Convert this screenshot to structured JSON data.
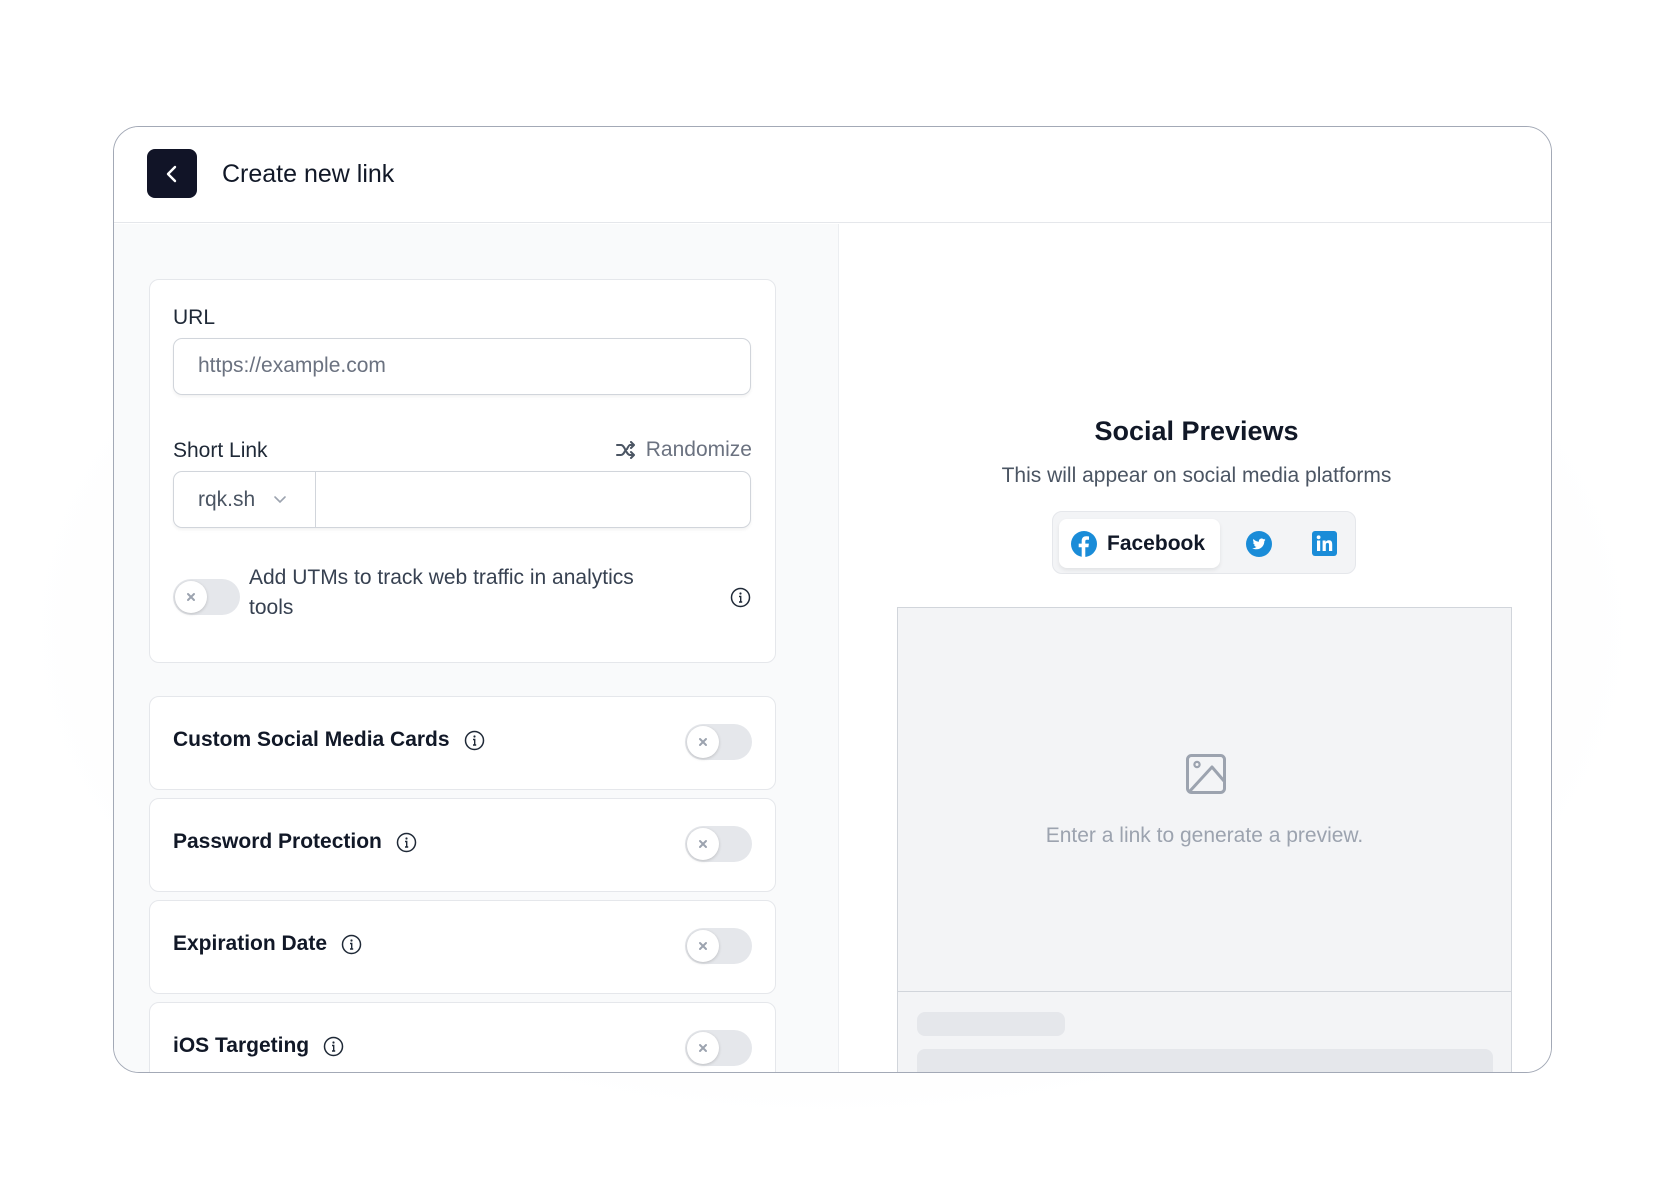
{
  "header": {
    "title": "Create new link",
    "back_icon": "chevron-left-icon"
  },
  "form": {
    "url": {
      "label": "URL",
      "placeholder": "https://example.com",
      "value": ""
    },
    "short_link": {
      "label": "Short Link",
      "randomize_label": "Randomize",
      "randomize_icon": "shuffle-icon",
      "domain": "rqk.sh",
      "key_value": ""
    },
    "utm": {
      "label": "Add UTMs to track web traffic in analytics tools",
      "enabled": false
    }
  },
  "features": [
    {
      "label": "Custom Social Media Cards",
      "enabled": false
    },
    {
      "label": "Password Protection",
      "enabled": false
    },
    {
      "label": "Expiration Date",
      "enabled": false
    },
    {
      "label": "iOS Targeting",
      "enabled": false
    }
  ],
  "preview": {
    "title": "Social Previews",
    "subtitle": "This will appear on social media platforms",
    "tabs": [
      {
        "label": "Facebook",
        "icon": "facebook-icon",
        "active": true
      },
      {
        "label": "Twitter",
        "icon": "twitter-icon",
        "active": false
      },
      {
        "label": "LinkedIn",
        "icon": "linkedin-icon",
        "active": false
      }
    ],
    "empty_text": "Enter a link to generate a preview.",
    "empty_icon": "image-icon"
  },
  "colors": {
    "brand_dark": "#111427",
    "social_blue": "#1a8cd8",
    "toggle_off": "#e5e7eb"
  }
}
